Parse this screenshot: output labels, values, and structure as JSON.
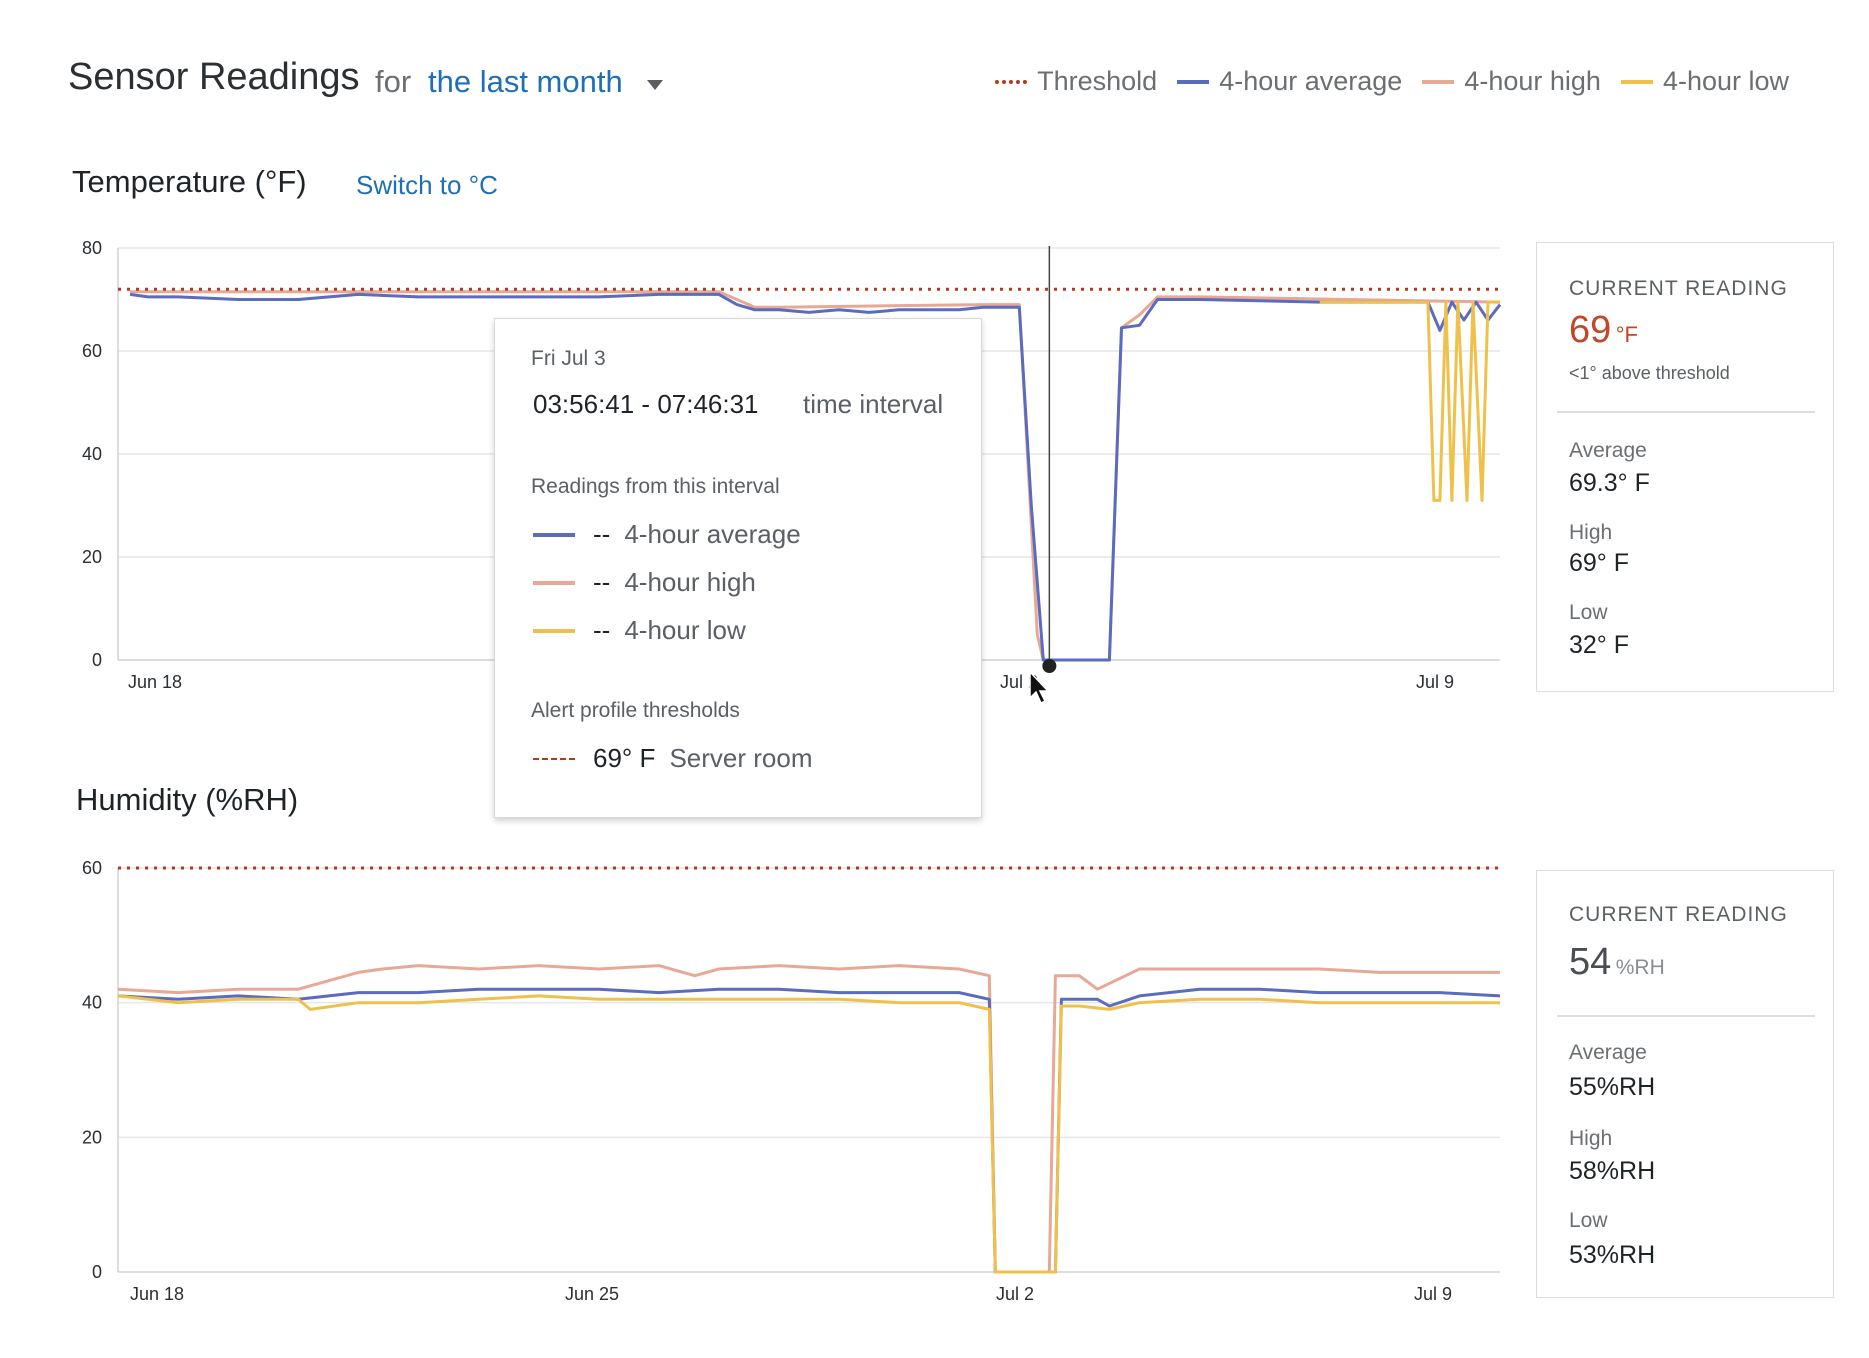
{
  "header": {
    "title": "Sensor Readings",
    "for_label": "for",
    "range_label": "the last month"
  },
  "legend": {
    "items": [
      {
        "label": "Threshold",
        "color": "#b23a1d",
        "style": "dotted"
      },
      {
        "label": "4-hour average",
        "color": "#5b6bbd",
        "style": "solid"
      },
      {
        "label": "4-hour high",
        "color": "#e8a896",
        "style": "solid"
      },
      {
        "label": "4-hour low",
        "color": "#efc14a",
        "style": "solid"
      }
    ]
  },
  "temperature": {
    "title": "Temperature (°F)",
    "switch_label": "Switch to °C",
    "panel": {
      "caption": "CURRENT READING",
      "value": "69",
      "unit": "°F",
      "note": "<1° above threshold",
      "value_color": "#c0472a",
      "average_label": "Average",
      "average_value": "69.3° F",
      "high_label": "High",
      "high_value": "69° F",
      "low_label": "Low",
      "low_value": "32° F"
    }
  },
  "humidity": {
    "title": "Humidity (%RH)",
    "panel": {
      "caption": "CURRENT READING",
      "value": "54",
      "unit": "%RH",
      "average_label": "Average",
      "average_value": "55%RH",
      "high_label": "High",
      "high_value": "58%RH",
      "low_label": "Low",
      "low_value": "53%RH"
    }
  },
  "tooltip": {
    "date": "Fri Jul 3",
    "time_range": "03:56:41 - 07:46:31",
    "time_label": "time interval",
    "readings_heading": "Readings from this interval",
    "rows": [
      {
        "value": "--",
        "label": "4-hour average",
        "color": "#5b6bbd"
      },
      {
        "value": "--",
        "label": "4-hour high",
        "color": "#e8a896"
      },
      {
        "value": "--",
        "label": "4-hour low",
        "color": "#efc14a"
      }
    ],
    "thresholds_heading": "Alert profile thresholds",
    "threshold_value": "69° F",
    "threshold_label": "Server room"
  },
  "chart_data": [
    {
      "type": "line",
      "title": "Temperature (°F)",
      "x_tick_labels": [
        "Jun 18",
        "Jun 25",
        "Jul 2",
        "Jul 9"
      ],
      "x_range_days": [
        17,
        40
      ],
      "ylim": [
        0,
        80
      ],
      "y_ticks": [
        0,
        20,
        40,
        60,
        80
      ],
      "grid": true,
      "threshold": 72,
      "cursor_day": 32.5,
      "series": [
        {
          "name": "4-hour high",
          "color": "#e8a896",
          "x": [
            17.2,
            27.0,
            27.3,
            27.6,
            28.0,
            31.4,
            32.0,
            32.3,
            32.4,
            33.5,
            33.7,
            34.0,
            34.3,
            35.0,
            40.0
          ],
          "y": [
            71.5,
            71.5,
            70.0,
            68.5,
            68.5,
            69.0,
            69.0,
            5.0,
            0.0,
            0.0,
            64.5,
            67.0,
            70.5,
            70.5,
            69.5
          ]
        },
        {
          "name": "4-hour average",
          "color": "#5b6bbd",
          "x": [
            17.2,
            17.5,
            18.0,
            19.0,
            20.0,
            21.0,
            22.0,
            23.0,
            24.0,
            25.0,
            26.0,
            27.0,
            27.3,
            27.6,
            28.0,
            28.5,
            29.0,
            29.5,
            30.0,
            31.0,
            31.4,
            32.0,
            32.2,
            32.4,
            33.5,
            33.7,
            34.0,
            34.3,
            35.0,
            37.0,
            38.8,
            39.0,
            39.2,
            39.4,
            39.6,
            39.8,
            40.0
          ],
          "y": [
            71.0,
            70.5,
            70.5,
            70.0,
            70.0,
            71.0,
            70.5,
            70.5,
            70.5,
            70.5,
            71.0,
            71.0,
            69.0,
            68.0,
            68.0,
            67.5,
            68.0,
            67.5,
            68.0,
            68.0,
            68.5,
            68.5,
            30.0,
            0.0,
            0.0,
            64.5,
            65.0,
            70.0,
            70.0,
            69.5,
            69.5,
            64.0,
            69.5,
            66.0,
            69.5,
            66.0,
            69.0
          ]
        },
        {
          "name": "4-hour low",
          "color": "#efc14a",
          "x": [
            37.0,
            38.8,
            38.9,
            39.0,
            39.1,
            39.2,
            39.3,
            39.45,
            39.55,
            39.7,
            39.8,
            40.0
          ],
          "y": [
            69.5,
            69.5,
            31.0,
            31.0,
            69.5,
            31.0,
            69.5,
            31.0,
            69.5,
            31.0,
            69.5,
            69.5
          ]
        }
      ]
    },
    {
      "type": "line",
      "title": "Humidity (%RH)",
      "x_tick_labels": [
        "Jun 18",
        "Jun 25",
        "Jul 2",
        "Jul 9"
      ],
      "x_range_days": [
        17,
        40
      ],
      "ylim": [
        0,
        60
      ],
      "y_ticks": [
        0,
        20,
        40,
        60
      ],
      "grid": true,
      "threshold": 60,
      "series": [
        {
          "name": "4-hour high",
          "color": "#e8a896",
          "x": [
            17.0,
            18.0,
            19.0,
            20.0,
            21.0,
            21.4,
            22.0,
            23.0,
            24.0,
            25.0,
            26.0,
            26.6,
            27.0,
            28.0,
            29.0,
            30.0,
            31.0,
            31.5,
            31.6,
            32.5,
            32.6,
            33.0,
            33.3,
            34.0,
            35.0,
            36.0,
            37.0,
            38.0,
            39.0,
            40.0
          ],
          "y": [
            42.0,
            41.5,
            42.0,
            42.0,
            44.5,
            45.0,
            45.5,
            45.0,
            45.5,
            45.0,
            45.5,
            44.0,
            45.0,
            45.5,
            45.0,
            45.5,
            45.0,
            44.0,
            0.0,
            0.0,
            44.0,
            44.0,
            42.0,
            45.0,
            45.0,
            45.0,
            45.0,
            44.5,
            44.5,
            44.5
          ]
        },
        {
          "name": "4-hour average",
          "color": "#5b6bbd",
          "x": [
            17.0,
            18.0,
            19.0,
            20.0,
            21.0,
            22.0,
            23.0,
            24.0,
            25.0,
            26.0,
            27.0,
            28.0,
            29.0,
            30.0,
            31.0,
            31.5,
            31.6,
            32.6,
            32.7,
            33.3,
            33.5,
            34.0,
            35.0,
            36.0,
            37.0,
            38.0,
            39.0,
            40.0
          ],
          "y": [
            41.0,
            40.5,
            41.0,
            40.5,
            41.5,
            41.5,
            42.0,
            42.0,
            42.0,
            41.5,
            42.0,
            42.0,
            41.5,
            41.5,
            41.5,
            40.5,
            0.0,
            0.0,
            40.5,
            40.5,
            39.5,
            41.0,
            42.0,
            42.0,
            41.5,
            41.5,
            41.5,
            41.0
          ]
        },
        {
          "name": "4-hour low",
          "color": "#efc14a",
          "x": [
            17.0,
            18.0,
            19.0,
            20.0,
            20.2,
            21.0,
            22.0,
            23.0,
            24.0,
            25.0,
            26.0,
            27.0,
            28.0,
            29.0,
            30.0,
            31.0,
            31.5,
            31.6,
            32.6,
            32.7,
            33.0,
            33.5,
            34.0,
            35.0,
            36.0,
            37.0,
            38.0,
            39.0,
            40.0
          ],
          "y": [
            41.0,
            40.0,
            40.5,
            40.5,
            39.0,
            40.0,
            40.0,
            40.5,
            41.0,
            40.5,
            40.5,
            40.5,
            40.5,
            40.5,
            40.0,
            40.0,
            39.0,
            0.0,
            0.0,
            39.5,
            39.5,
            39.0,
            40.0,
            40.5,
            40.5,
            40.0,
            40.0,
            40.0,
            40.0
          ]
        }
      ]
    }
  ]
}
